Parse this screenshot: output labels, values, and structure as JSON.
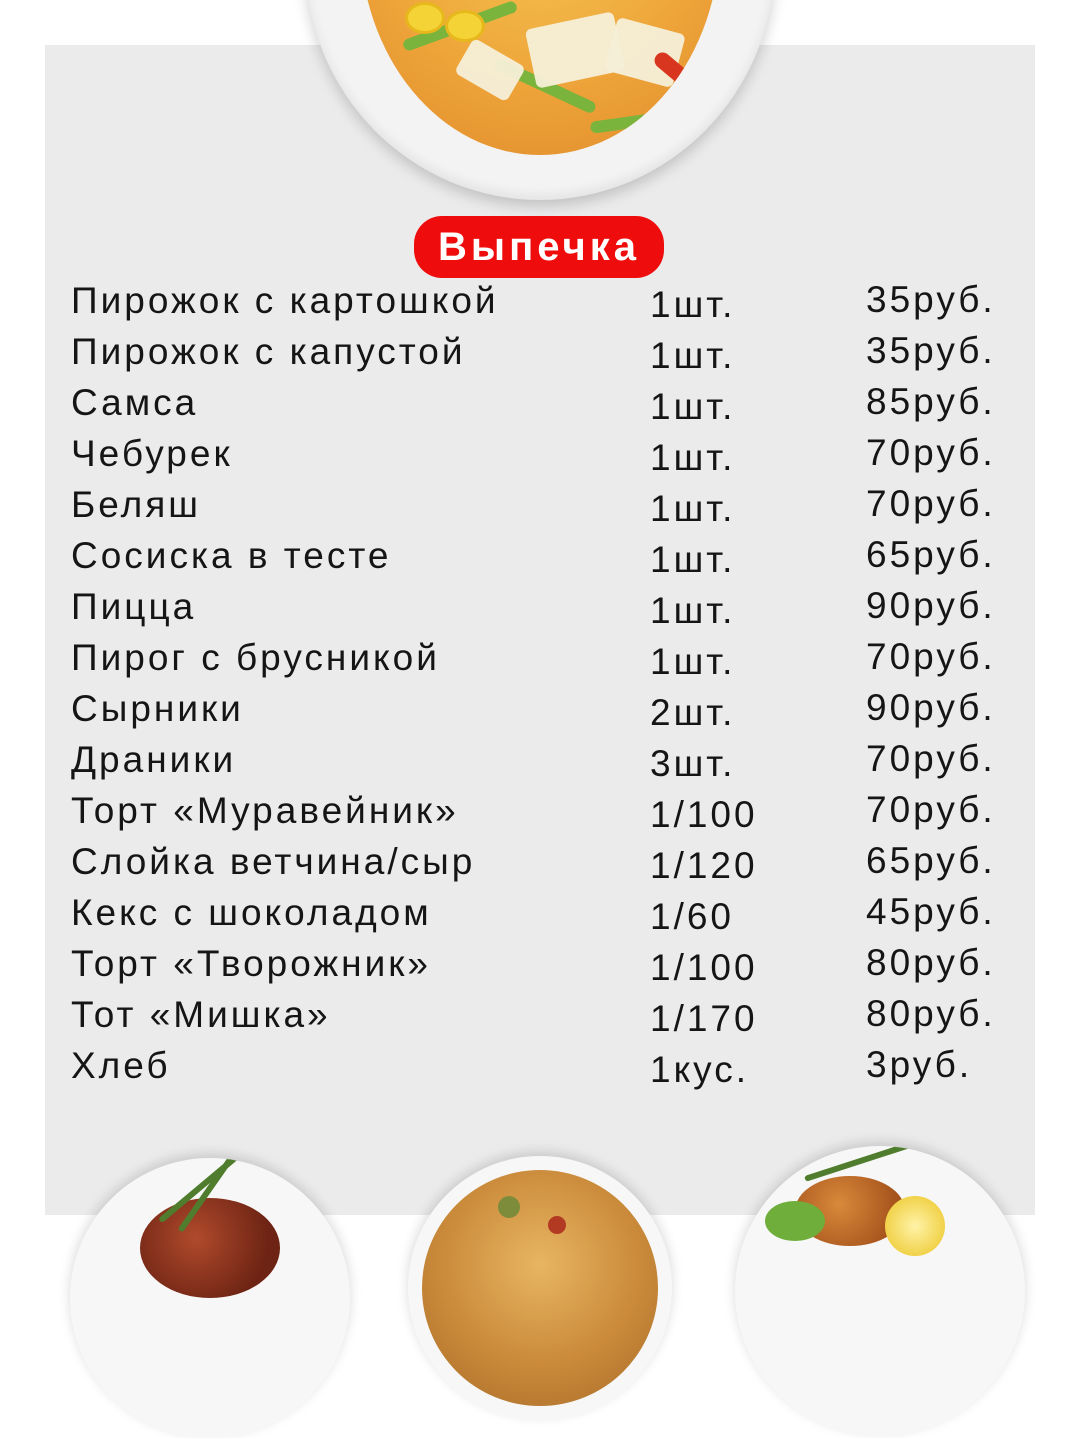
{
  "section_title": "Выпечка",
  "items": [
    {
      "name": "Пирожок с картошкой",
      "qty": "1шт.",
      "price": "35руб."
    },
    {
      "name": "Пирожок с капустой",
      "qty": "1шт.",
      "price": "35руб."
    },
    {
      "name": "Самса",
      "qty": "1шт.",
      "price": "85руб."
    },
    {
      "name": "Чебурек",
      "qty": "1шт.",
      "price": "70руб."
    },
    {
      "name": "Беляш",
      "qty": "1шт.",
      "price": "70руб."
    },
    {
      "name": "Сосиска в тесте",
      "qty": "1шт.",
      "price": "65руб."
    },
    {
      "name": "Пицца",
      "qty": "1шт.",
      "price": "90руб."
    },
    {
      "name": "Пирог с брусникой",
      "qty": "1шт.",
      "price": "70руб."
    },
    {
      "name": "Сырники",
      "qty": "2шт.",
      "price": "90руб."
    },
    {
      "name": "Драники",
      "qty": "3шт.",
      "price": "70руб."
    },
    {
      "name": "Торт «Муравейник»",
      "qty": "1/100",
      "price": "70руб."
    },
    {
      "name": "Слойка ветчина/сыр",
      "qty": "1/120",
      "price": "65руб."
    },
    {
      "name": "Кекс с шоколадом",
      "qty": "1/60",
      "price": "45руб."
    },
    {
      "name": "Торт «Творожник»",
      "qty": "1/100",
      "price": "80руб."
    },
    {
      "name": "Тот «Мишка»",
      "qty": "1/170",
      "price": "80руб."
    },
    {
      "name": "Хлеб",
      "qty": "1кус.",
      "price": "3руб."
    }
  ],
  "colors": {
    "accent": "#ef0c0c",
    "panel_background": "#ebebec",
    "page_background": "#ffffff",
    "text": "#151515"
  },
  "images": [
    "soup-bowl-photo",
    "steak-plate-photo",
    "pizza-plate-photo",
    "roast-chicken-plate-photo"
  ]
}
